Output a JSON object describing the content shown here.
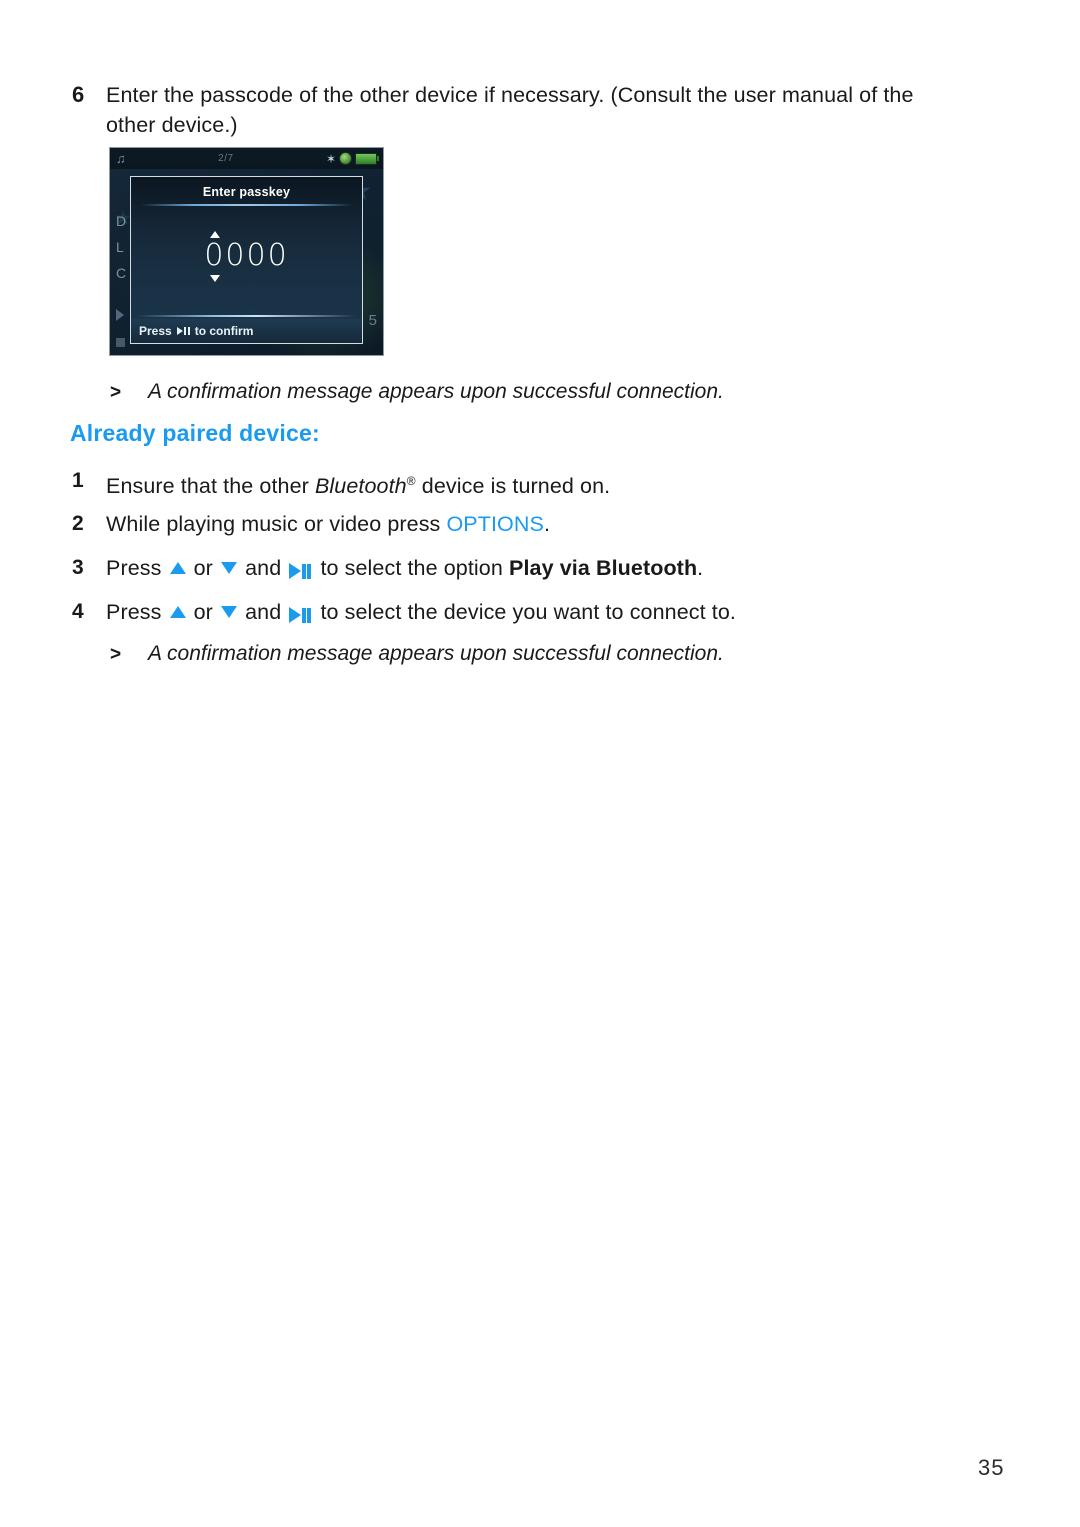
{
  "document": {
    "page_number": "35",
    "accent_color": "#1a9bf0"
  },
  "step6": {
    "number": "6",
    "text": "Enter the passcode of the other device if necessary. (Consult the user manual of the other device.)"
  },
  "device_screenshot": {
    "status_bar": {
      "music_note_icon": "♫",
      "track_indicator": "2/7",
      "bluetooth_icon": "✶",
      "shield_icon": "shield",
      "battery_icon": "battery"
    },
    "background_menu_items": [
      "D",
      "L",
      "C"
    ],
    "background_right_text": "5",
    "dialog": {
      "title": "Enter passkey",
      "passkey_value": "0000",
      "footer_prefix": "Press",
      "footer_suffix": "to confirm"
    }
  },
  "result_line_1": {
    "caret": ">",
    "text": "A confirmation message appears upon successful connection."
  },
  "section_heading": "Already paired device:",
  "steps": [
    {
      "number": "1",
      "prefix": "Ensure that the other ",
      "italic": "Bluetooth",
      "sup": "®",
      "suffix": " device is turned on."
    },
    {
      "number": "2",
      "prefix": "While playing music or video press ",
      "blue": "OPTIONS",
      "suffix": "."
    },
    {
      "number": "3",
      "press_label": "Press",
      "or_label": "or",
      "and_label": "and",
      "tail_prefix": "to select the option ",
      "bold": "Play via Bluetooth",
      "suffix": "."
    },
    {
      "number": "4",
      "press_label": "Press",
      "or_label": "or",
      "and_label": "and",
      "tail_prefix": "to select the device you want to connect to.",
      "bold": "",
      "suffix": ""
    }
  ],
  "result_line_2": {
    "caret": ">",
    "text": "A confirmation message appears upon successful connection."
  }
}
